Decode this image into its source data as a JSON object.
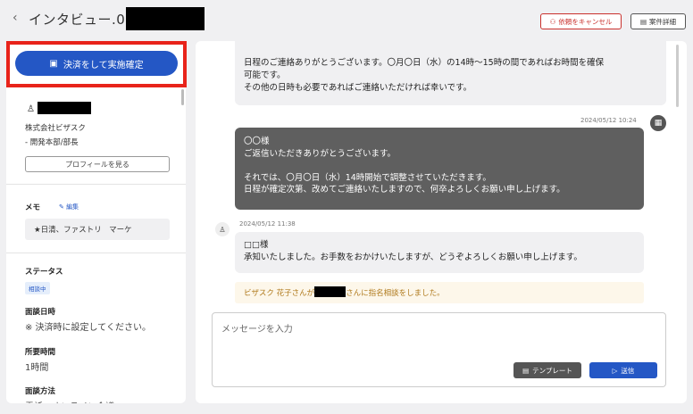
{
  "header": {
    "back_icon": "‹",
    "title": "インタビュー.03 / ",
    "cancel_label": "依頼をキャンセル",
    "detail_label": "案件詳細",
    "cancel_icon": "person-minus-icon",
    "detail_icon": "document-icon"
  },
  "sidebar": {
    "settle_button": "決済をして実施確定",
    "company": "株式会社ビザスク",
    "department": "- 開発本部/部長",
    "profile_button": "プロフィールを見る",
    "memo_label": "メモ",
    "memo_edit": "編集",
    "memo_text": "★日清、ファストリ　マーケ",
    "status_label": "ステータス",
    "status_badge": "相談中",
    "date_label": "面談日時",
    "date_value": "※ 決済時に設定してください。",
    "duration_label": "所要時間",
    "duration_value": "1時間",
    "method_label": "面談方法",
    "method_value": "電話・オンライン会議"
  },
  "messages": {
    "msg1_line1": "日程のご連絡ありがとうございます。〇月〇日（水）の14時〜15時の間であればお時間を確保",
    "msg1_line2": "可能です。",
    "msg1_line3": "その他の日時も必要であればご連絡いただければ幸いです。",
    "msg2_timestamp": "2024/05/12 10:24",
    "msg2_line1": "〇〇様",
    "msg2_line2": "ご返信いただきありがとうございます。",
    "msg2_line3": "それでは、〇月〇日（水）14時開始で調整させていただきます。",
    "msg2_line4": "日程が確定次第、改めてご連絡いたしますので、何卒よろしくお願い申し上げます。",
    "msg3_timestamp": "2024/05/12 11:38",
    "msg3_line1": "□□様",
    "msg3_line2": "承知いたしました。お手数をおかけいたしますが、どうぞよろしくお願い申し上げます。",
    "notice_prefix": "ビザスク 花子さんが",
    "notice_suffix": "さんに指名相談をしました。"
  },
  "composer": {
    "placeholder": "メッセージを入力",
    "template_button": "テンプレート",
    "send_button": "送信"
  },
  "colors": {
    "primary": "#2457c5",
    "danger": "#c9302c",
    "highlight": "#e8231a",
    "notice_text": "#b07a1c"
  }
}
